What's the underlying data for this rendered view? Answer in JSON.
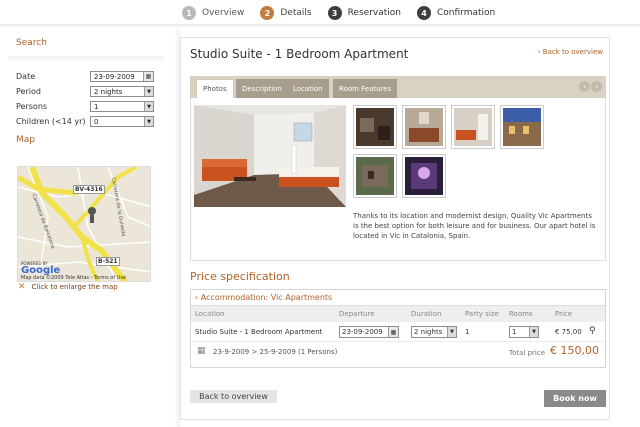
{
  "steps": [
    {
      "num": "1",
      "label": "Overview"
    },
    {
      "num": "2",
      "label": "Details"
    },
    {
      "num": "3",
      "label": "Reservation"
    },
    {
      "num": "4",
      "label": "Confirmation"
    }
  ],
  "search": {
    "title": "Search",
    "date_label": "Date",
    "date_value": "23-09-2009",
    "period_label": "Period",
    "period_value": "2 nights",
    "persons_label": "Persons",
    "persons_value": "1",
    "children_label": "Children (<14 yr)",
    "children_value": "0"
  },
  "map": {
    "title": "Map",
    "road_a": "BV-4316",
    "road_b": "B-521",
    "street_a": "Carretera de Barcelona",
    "street_b": "Carretera de la Guixeda",
    "powered_by": "POWERED BY",
    "logo": "Google",
    "copyright": "Map data ©2009 Tele Atlas - Terms of Use",
    "enlarge_icon": "expand-icon",
    "enlarge_label": "Click to enlarge the map"
  },
  "detail": {
    "title": "Studio Suite - 1 Bedroom Apartment",
    "back_link": "‹ Back to overview",
    "tabs": [
      "Photos",
      "Description",
      "Location",
      "Room Features"
    ],
    "arrow_prev": "‹",
    "arrow_next": "›",
    "description": "Thanks to its location and modernist design, Quality Vic Apartments is the best option for both leisure and for business. Our apart hotel is located in Vic in Catalonia, Spain."
  },
  "price": {
    "title": "Price specification",
    "accommodation": "› Accommodation: Vic Apartments",
    "headers": {
      "location": "Location",
      "departure": "Departure",
      "duration": "Duration",
      "party": "Party size",
      "rooms": "Rooms",
      "price": "Price"
    },
    "row": {
      "location": "Studio Suite - 1 Bedroom Apartment",
      "departure": "23-09-2009",
      "duration": "2 nights",
      "party": "1",
      "rooms": "1",
      "price": "€ 75,00"
    },
    "summary": "23-9-2009 > 25-9-2009 (1 Persons)",
    "total_label": "Total price",
    "total_value": "€ 150,00"
  },
  "buttons": {
    "back": "Back to overview",
    "book": "Book now"
  },
  "colors": {
    "accent": "#b0622a",
    "step_active": "#c5793e",
    "tabs_bg": "#d8d2c3"
  }
}
